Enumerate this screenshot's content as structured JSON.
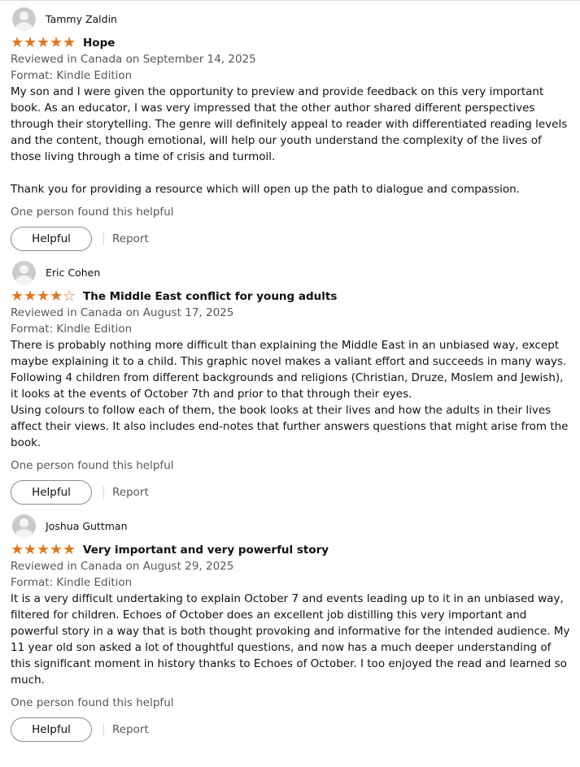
{
  "colors": {
    "star": "#de7921",
    "meta_text": "#565959",
    "body_text": "#0f1111"
  },
  "reviews": [
    {
      "author": "Tammy Zaldin",
      "rating": 5,
      "title": "Hope",
      "reviewed": "Reviewed in Canada on September 14, 2025",
      "format": "Format: Kindle Edition",
      "body": [
        "My son and I were given the opportunity to preview and provide feedback on this very important book. As an educator, I was very impressed that the other author shared different perspectives through their storytelling. The genre will definitely appeal to reader with differentiated reading levels and the content, though emotional, will help our youth understand the complexity of the lives of those living through a time of crisis and turmoil.",
        "Thank you for providing a resource which will open up the path to dialogue and compassion."
      ],
      "helpful_count": "One person found this helpful",
      "helpful_label": "Helpful",
      "report_label": "Report"
    },
    {
      "author": "Eric Cohen",
      "rating": 4,
      "title": "The Middle East conflict for young adults",
      "reviewed": "Reviewed in Canada on August 17, 2025",
      "format": "Format: Kindle Edition",
      "body": [
        "There is probably nothing more difficult than explaining the Middle East in an unbiased way, except maybe explaining it to a child. This graphic novel makes a valiant effort and succeeds in many ways.",
        "Following 4 children from different backgrounds and religions (Christian, Druze, Moslem and Jewish), it looks at the events of October 7th and prior to that through their eyes.",
        "Using colours to follow each of them, the book looks at their lives and how the adults in their lives affect their views. It also includes end-notes that further answers questions that might arise from the book."
      ],
      "helpful_count": "One person found this helpful",
      "helpful_label": "Helpful",
      "report_label": "Report"
    },
    {
      "author": "Joshua Guttman",
      "rating": 5,
      "title": "Very important and very powerful story",
      "reviewed": "Reviewed in Canada on August 29, 2025",
      "format": "Format: Kindle Edition",
      "body": [
        "It is a very difficult undertaking to explain October 7 and events leading up to it in an unbiased way, filtered for children. Echoes of October does an excellent job distilling this very important and powerful story in a way that is both thought provoking and informative for the intended audience. My 11 year old son asked a lot of thoughtful questions, and now has a much deeper understanding of this significant moment in history thanks to Echoes of October. I too enjoyed the read and learned so much."
      ],
      "helpful_count": "One person found this helpful",
      "helpful_label": "Helpful",
      "report_label": "Report"
    }
  ]
}
